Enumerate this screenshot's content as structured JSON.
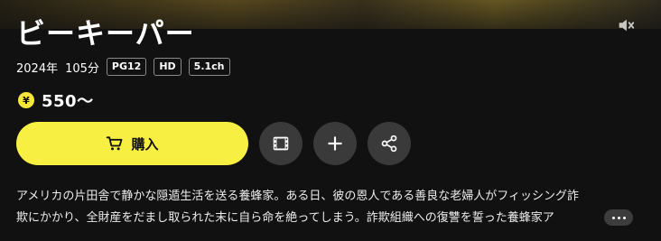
{
  "title": "ビーキーパー",
  "meta": {
    "year": "2024年",
    "duration": "105分",
    "badges": [
      "PG12",
      "HD",
      "5.1ch"
    ]
  },
  "price": {
    "currency_symbol": "¥",
    "text": "550〜"
  },
  "actions": {
    "purchase_label": "購入"
  },
  "description": {
    "line1": "アメリカの片田舎で静かな隠遁生活を送る養蜂家。ある日、彼の恩人である善良な老婦人がフィッシング詐",
    "line2": "欺にかかり、全財産をだまし取られた末に自ら命を絶ってしまう。詐欺組織への復讐を誓った養蜂家ア"
  },
  "colors": {
    "accent": "#f8ef43",
    "background": "#111111",
    "icon_button_bg": "#3a3a3a"
  },
  "icons": [
    "mute-icon",
    "yen-icon",
    "cart-icon",
    "film-icon",
    "plus-icon",
    "share-icon",
    "more-icon"
  ]
}
